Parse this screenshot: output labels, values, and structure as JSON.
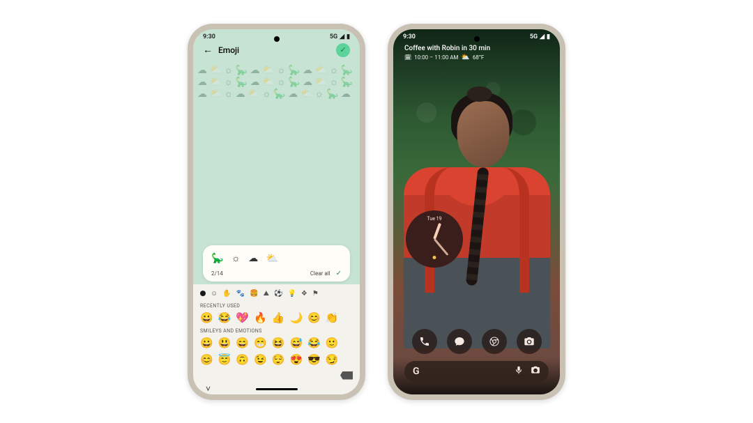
{
  "phone1": {
    "status": {
      "time": "9:30",
      "network": "5G"
    },
    "header": {
      "title": "Emoji"
    },
    "compose": {
      "preview": "🦕 ☼ ☁ ⛅",
      "counter": "2/14",
      "clear_label": "Clear all"
    },
    "keyboard": {
      "recently_label": "RECENTLY USED",
      "smileys_label": "SMILEYS AND EMOTIONS",
      "recent_row": [
        "😀",
        "😂",
        "💖",
        "🔥",
        "👍",
        "🌙",
        "😊",
        "👏"
      ],
      "smileys_row1": [
        "😀",
        "😃",
        "😄",
        "😁",
        "😆",
        "😅",
        "😂",
        "🙂"
      ],
      "smileys_row2": [
        "😊",
        "😇",
        "🙃",
        "😉",
        "😌",
        "😍",
        "😎",
        "😏"
      ]
    }
  },
  "phone2": {
    "status": {
      "time": "9:30",
      "network": "5G"
    },
    "glance": {
      "title": "Coffee with Robin in 30 min",
      "time_range": "10:00 – 11:00 AM",
      "temperature": "68°F"
    },
    "clock": {
      "date_label": "Tue 19"
    },
    "search": {
      "logo_text": "G"
    }
  }
}
